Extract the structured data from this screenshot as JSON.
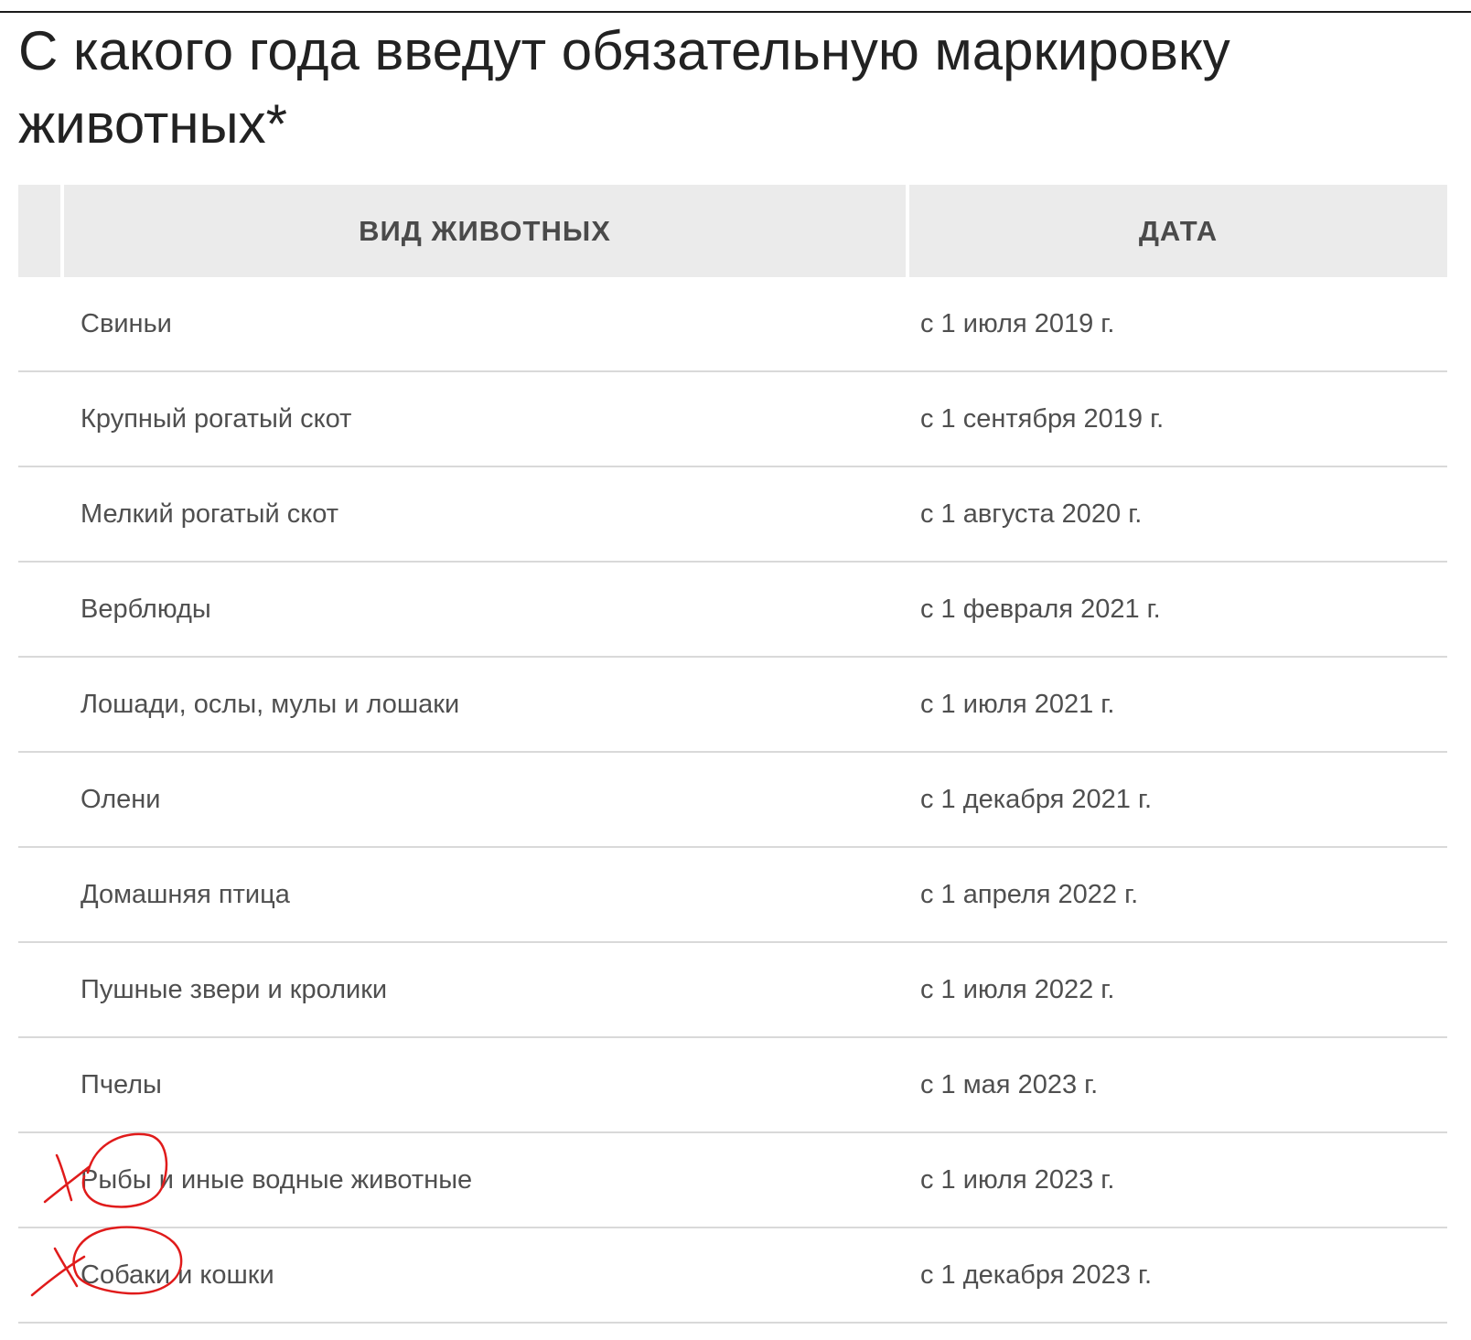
{
  "title": "С какого года введут обязательную маркировку животных*",
  "table": {
    "headers": {
      "corner": "",
      "animal": "ВИД ЖИВОТНЫХ",
      "date": "ДАТА"
    },
    "rows": [
      {
        "animal": "Свиньи",
        "date": "с 1 июля 2019 г."
      },
      {
        "animal": "Крупный рогатый скот",
        "date": "с 1 сентября 2019 г."
      },
      {
        "animal": "Мелкий рогатый скот",
        "date": "с 1 августа 2020 г."
      },
      {
        "animal": "Верблюды",
        "date": "с 1 февраля 2021 г."
      },
      {
        "animal": "Лошади, ослы, мулы и лошаки",
        "date": "с 1 июля 2021 г."
      },
      {
        "animal": "Олени",
        "date": "с 1 декабря 2021 г."
      },
      {
        "animal": "Домашняя птица",
        "date": "с 1 апреля 2022 г."
      },
      {
        "animal": "Пушные звери и кролики",
        "date": "с 1 июля 2022 г."
      },
      {
        "animal": "Пчелы",
        "date": "с 1 мая 2023 г."
      },
      {
        "animal": "Рыбы и иные водные животные",
        "date": "с 1 июля 2023 г."
      },
      {
        "animal": "Собаки и кошки",
        "date": "с 1 декабря 2023 г."
      }
    ]
  },
  "annotations": {
    "color": "#e01b1b",
    "marks": [
      {
        "name": "red-circle-cross-fish",
        "row": 9
      },
      {
        "name": "red-circle-cross-dogs",
        "row": 10
      }
    ]
  }
}
